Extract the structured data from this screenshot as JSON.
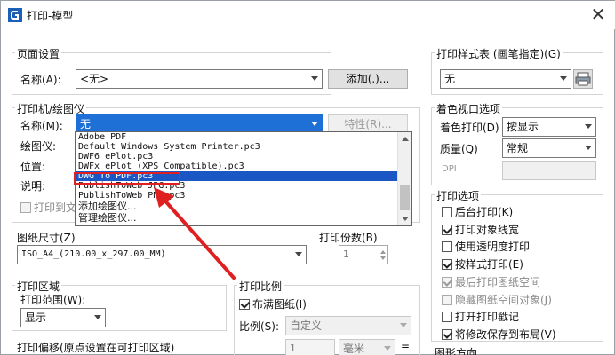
{
  "window": {
    "title": "打印-模型",
    "close_glyph": "✕"
  },
  "page_setup": {
    "group_label": "页面设置",
    "name_label": "名称(A):",
    "name_value": "<无>",
    "add_button": "添加(.)..."
  },
  "printer": {
    "group_label": "打印机/绘图仪",
    "name_label": "名称(M):",
    "name_value": "无",
    "properties_button": "特性(R)...",
    "plotter_label": "绘图仪:",
    "location_label": "位置:",
    "description_label": "说明:",
    "print_to_file_label": "打印到文",
    "dropdown_items": [
      "Adobe PDF",
      "Default Windows System Printer.pc3",
      "DWF6 ePlot.pc3",
      "DWFx ePlot (XPS Compatible).pc3",
      "DWG To PDF.pc3",
      "PublishToWeb JPG.pc3",
      "PublishToWeb PNG.pc3",
      "添加绘图仪...",
      "管理绘图仪..."
    ],
    "selected_item_index": 4
  },
  "paper_size": {
    "group_label": "图纸尺寸(Z)",
    "value": "ISO_A4_(210.00_x_297.00_MM)"
  },
  "copies": {
    "group_label": "打印份数(B)",
    "value": "1"
  },
  "plot_area": {
    "group_label": "打印区域",
    "range_label": "打印范围(W):",
    "range_value": "显示"
  },
  "plot_offset": {
    "group_label": "打印偏移(原点设置在可打印区域)"
  },
  "plot_scale": {
    "group_label": "打印比例",
    "fit_to_paper_label": "布满图纸(I)",
    "fit_to_paper_checked": true,
    "scale_label": "比例(S):",
    "scale_value": "自定义",
    "scale_number": "1",
    "unit_value": "毫米",
    "equals": "="
  },
  "plot_style_table": {
    "group_label": "打印样式表 (画笔指定)(G)",
    "value": "无"
  },
  "shaded_viewport": {
    "group_label": "着色视口选项",
    "shade_label": "着色打印(D)",
    "shade_value": "按显示",
    "quality_label": "质量(Q)",
    "quality_value": "常规",
    "dpi_label": "DPI"
  },
  "plot_options": {
    "group_label": "打印选项",
    "items": [
      {
        "label": "后台打印(K)",
        "checked": false,
        "enabled": true
      },
      {
        "label": "打印对象线宽",
        "checked": true,
        "enabled": true
      },
      {
        "label": "使用透明度打印",
        "checked": false,
        "enabled": true
      },
      {
        "label": "按样式打印(E)",
        "checked": true,
        "enabled": true
      },
      {
        "label": "最后打印图纸空间",
        "checked": true,
        "enabled": false
      },
      {
        "label": "隐藏图纸空间对象(J)",
        "checked": false,
        "enabled": false
      },
      {
        "label": "打开打印戳记",
        "checked": false,
        "enabled": true
      },
      {
        "label": "将修改保存到布局(V)",
        "checked": true,
        "enabled": true
      }
    ]
  },
  "drawing_orientation": {
    "group_label": "图形方向"
  },
  "colors": {
    "selection": "#1e6fd6",
    "annotation": "#e02020"
  }
}
